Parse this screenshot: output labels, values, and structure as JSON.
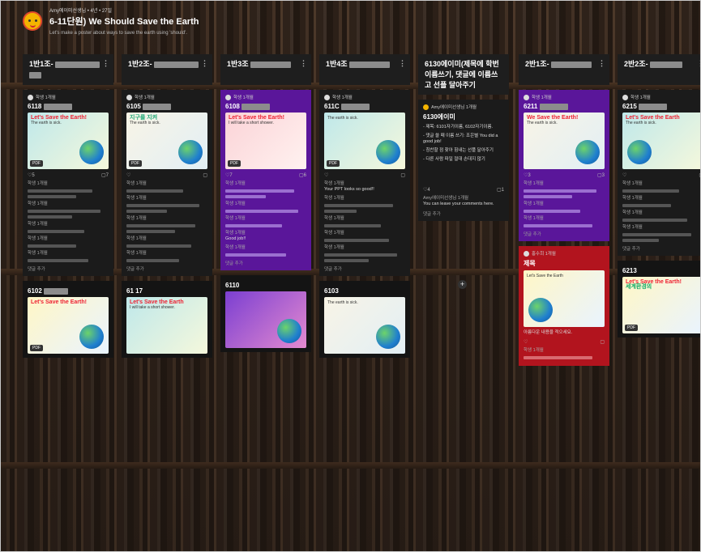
{
  "header": {
    "meta": "Amy에이미선생님 • 4년 • 27일",
    "title": "6-11단원) We Should Save the Earth",
    "subtitle": "Let's make a poster about ways to save the earth using 'should'."
  },
  "columns": [
    {
      "heading": "1반1조-",
      "first_number": "6118",
      "second_number": "6102"
    },
    {
      "heading": "1반2조-",
      "first_number": "6105",
      "second_number": "61 17"
    },
    {
      "heading": "1반3조",
      "first_number": "6108",
      "second_number": "6110"
    },
    {
      "heading": "1반4조",
      "first_number": "611C",
      "second_number": "6103"
    },
    {
      "heading": "6130에이미(제목에 학번 이름쓰기, 댓글에 이름쓰고 선플 달아주기",
      "first_number": "6130에이미"
    },
    {
      "heading": "2반1조-",
      "first_number": "6211",
      "second_number": "제목"
    },
    {
      "heading": "2반2조-",
      "first_number": "6215",
      "second_number": "6213"
    }
  ],
  "instructions": [
    "- 제목: 6101자기이름, 6102자기이름.",
    "- 댓글 쓸 때 이름 쓰기: 조은별 You did a good job!",
    "- 칭찬할 점 찾아 힘내는 선플 달아주기",
    "- 다른 사람 파일 절대 손대지 않기"
  ],
  "comments": {
    "you_can_leave": "You can leave your comments here.",
    "add_comment": "댓글 추가",
    "good_job": "Good job!!",
    "ppt_good": "Your PPT looks so good!!"
  },
  "posters": {
    "lets_save": "Let's Save the Earth!",
    "we_save": "We Save the Earth!",
    "save_earth_small": "Let's Save the Earth",
    "earth_sick": "The earth is sick.",
    "korean_title": "지구를 지켜",
    "korean_title2": "세계환경의",
    "take_short_shower": "I will take a short shower.",
    "red_body": "아름다운 내용을 적으세요."
  },
  "labels": {
    "pdf": "PDF",
    "author": "학생 1개월",
    "teacher": "Amy에이미선생님 1개월",
    "red_author": "홍수희 1개월"
  },
  "stats": {
    "likes_col1": "5",
    "comments_col1": "7",
    "likes_col3": "7",
    "comments_col3": "6",
    "likes_col5": "4",
    "comments_col5": "1",
    "likes_col6": "3",
    "comments_col6": "3"
  },
  "colors": {
    "purple_card": "#5a169a",
    "red_card": "#b2141e",
    "dark_card": "#1b1b1b"
  }
}
